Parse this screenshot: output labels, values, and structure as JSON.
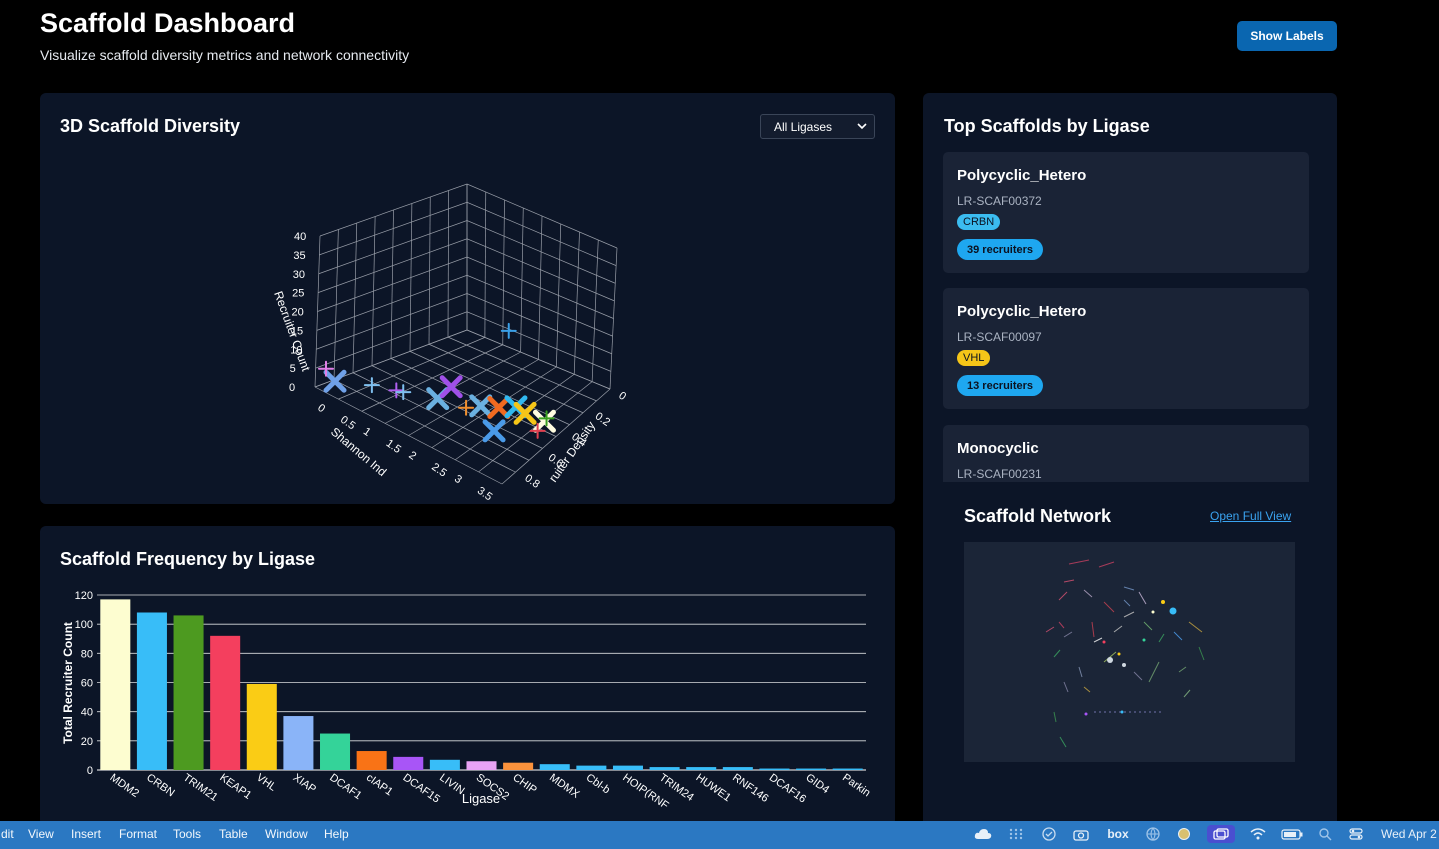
{
  "header": {
    "title": "Scaffold Dashboard",
    "subtitle": "Visualize scaffold diversity metrics and network connectivity",
    "show_labels_button": "Show Labels"
  },
  "diversity_panel": {
    "title": "3D Scaffold Diversity",
    "filter_selected": "All Ligases"
  },
  "frequency_panel": {
    "title": "Scaffold Frequency by Ligase"
  },
  "top_scaffolds_panel": {
    "title": "Top Scaffolds by Ligase",
    "cards": [
      {
        "name": "Polycyclic_Hetero",
        "id": "LR-SCAF00372",
        "ligase": "CRBN",
        "ligase_color": "#3bbcf0",
        "recruiters": "39 recruiters"
      },
      {
        "name": "Polycyclic_Hetero",
        "id": "LR-SCAF00097",
        "ligase": "VHL",
        "ligase_color": "#f5c518",
        "recruiters": "13 recruiters"
      },
      {
        "name": "Monocyclic",
        "id": "LR-SCAF00231"
      }
    ]
  },
  "network_panel": {
    "title": "Scaffold Network",
    "open_full_view": "Open Full View"
  },
  "menubar": {
    "items": [
      "dit",
      "View",
      "Insert",
      "Format",
      "Tools",
      "Table",
      "Window",
      "Help"
    ],
    "tray_icons": [
      "cloud-icon",
      "grid-icon",
      "check-circle-icon",
      "camera-icon",
      "box-text",
      "globe-icon",
      "circle-icon",
      "window-icon",
      "wifi-icon",
      "battery-icon",
      "search-icon",
      "control-center-icon"
    ],
    "box_label": "box",
    "clock": "Wed Apr 2"
  },
  "chart_data": [
    {
      "type": "scatter3d",
      "title": "",
      "x_axis": {
        "label": "Shannon Ind",
        "ticks": [
          "0",
          "0.5",
          "1",
          "1.5",
          "2",
          "2.5",
          "3",
          "3.5"
        ]
      },
      "y_axis": {
        "label": "ruiter Density",
        "ticks": [
          "0",
          "0.2",
          "0.4",
          "0.6",
          "0.8"
        ]
      },
      "z_axis": {
        "label": "Recruiter Count",
        "ticks": [
          "0",
          "5",
          "10",
          "15",
          "20",
          "25",
          "30",
          "35",
          "40"
        ]
      },
      "points": [
        {
          "shannon": 0.2,
          "density": 0.05,
          "count": 2,
          "color": "#6fa0e8",
          "marker": "x"
        },
        {
          "shannon": 0.1,
          "density": 0.03,
          "count": 5,
          "color": "#e080e8",
          "marker": "+"
        },
        {
          "shannon": 0.9,
          "density": 0.05,
          "count": 6,
          "color": "#7fc0f0",
          "marker": "+"
        },
        {
          "shannon": 1.3,
          "density": 0.07,
          "count": 7,
          "color": "#b060f0",
          "marker": "+"
        },
        {
          "shannon": 1.4,
          "density": 0.08,
          "count": 7,
          "color": "#7fc0f0",
          "marker": "+"
        },
        {
          "shannon": 2.0,
          "density": 0.1,
          "count": 9,
          "color": "#6ab0e0",
          "marker": "x"
        },
        {
          "shannon": 2.2,
          "density": 0.12,
          "count": 13,
          "color": "#a050e8",
          "marker": "x"
        },
        {
          "shannon": 2.4,
          "density": 0.15,
          "count": 8,
          "color": "#f09030",
          "marker": "+"
        },
        {
          "shannon": 2.6,
          "density": 0.18,
          "count": 9,
          "color": "#6ab0e0",
          "marker": "x"
        },
        {
          "shannon": 2.9,
          "density": 0.2,
          "count": 10,
          "color": "#f06a20",
          "marker": "x"
        },
        {
          "shannon": 3.1,
          "density": 0.25,
          "count": 10,
          "color": "#30b8f0",
          "marker": "x"
        },
        {
          "shannon": 3.2,
          "density": 0.28,
          "count": 8,
          "color": "#f5c518",
          "marker": "x"
        },
        {
          "shannon": 3.3,
          "density": 0.02,
          "count": 12,
          "color": "#4a9ae8",
          "marker": "x"
        },
        {
          "shannon": 3.5,
          "density": 0.05,
          "count": 39,
          "color": "#3aa0e8",
          "marker": "+"
        },
        {
          "shannon": 3.4,
          "density": 0.35,
          "count": 5,
          "color": "#fffde0",
          "marker": "x"
        },
        {
          "shannon": 3.5,
          "density": 0.33,
          "count": 7,
          "color": "#3aa020",
          "marker": "+"
        },
        {
          "shannon": 3.4,
          "density": 0.3,
          "count": 4,
          "color": "#e04050",
          "marker": "+"
        }
      ]
    },
    {
      "type": "bar",
      "title": "",
      "xlabel": "Ligase",
      "ylabel": "Total Recruiter Count",
      "ylim": [
        0,
        120
      ],
      "yticks": [
        0,
        20,
        40,
        60,
        80,
        100,
        120
      ],
      "grid": true,
      "categories": [
        "MDM2",
        "CRBN",
        "TRIM21",
        "KEAP1",
        "VHL",
        "XIAP",
        "DCAF1",
        "cIAP1",
        "DCAF15",
        "LIVIN",
        "SOCS2",
        "CHIP",
        "MDMX",
        "Cbl-b",
        "HOIP(RNF",
        "TRIM24",
        "HUWE1",
        "RNF146",
        "DCAF16",
        "GID4",
        "Parkin"
      ],
      "values": [
        117,
        108,
        106,
        92,
        59,
        37,
        25,
        13,
        9,
        7,
        6,
        5,
        4,
        3,
        3,
        2,
        2,
        2,
        1,
        1,
        1
      ],
      "colors": [
        "#fdfdd0",
        "#38bdf8",
        "#4d9a20",
        "#f43f5e",
        "#facc15",
        "#8ab4f8",
        "#34d399",
        "#f97316",
        "#a855f7",
        "#38bdf8",
        "#e9a3f5",
        "#fb923c",
        "#38bdf8",
        "#38bdf8",
        "#38bdf8",
        "#38bdf8",
        "#38bdf8",
        "#38bdf8",
        "#38bdf8",
        "#38bdf8",
        "#38bdf8"
      ]
    }
  ]
}
